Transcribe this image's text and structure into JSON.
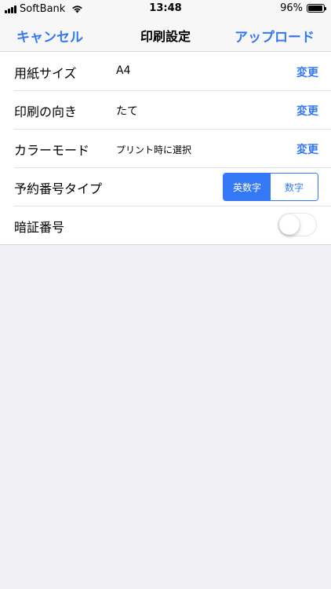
{
  "status_bar": {
    "carrier": "SoftBank",
    "time": "13:48",
    "battery_percent": "96%",
    "battery_level": 0.96
  },
  "nav": {
    "cancel_label": "キャンセル",
    "title": "印刷設定",
    "upload_label": "アップロード"
  },
  "settings": {
    "paper_size": {
      "label": "用紙サイズ",
      "value": "A4",
      "action": "変更"
    },
    "orientation": {
      "label": "印刷の向き",
      "value": "たて",
      "action": "変更"
    },
    "color_mode": {
      "label": "カラーモード",
      "value": "プリント時に選択",
      "action": "変更"
    },
    "reservation_type": {
      "label": "予約番号タイプ",
      "options": [
        "英数字",
        "数字"
      ],
      "selected": "英数字"
    },
    "pin": {
      "label": "暗証番号",
      "enabled": false
    }
  },
  "colors": {
    "accent": "#3478f6",
    "background": "#efeff4"
  }
}
